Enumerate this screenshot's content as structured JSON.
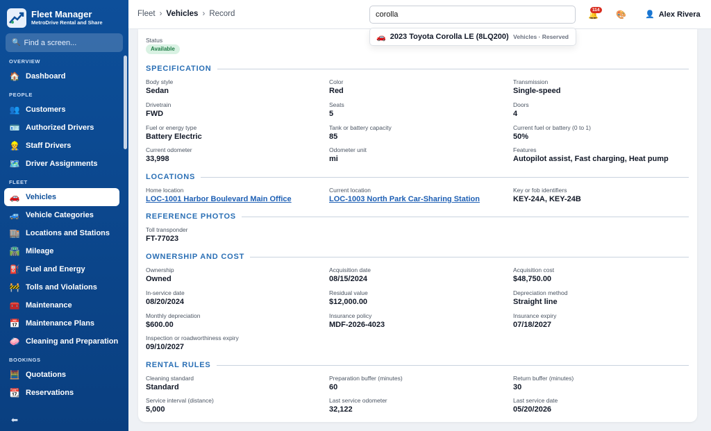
{
  "app": {
    "name": "Fleet Manager",
    "subtitle": "MetroDrive Rental and Share",
    "find_placeholder": "Find a screen..."
  },
  "sidebar": {
    "sections": {
      "overview": "OVERVIEW",
      "people": "PEOPLE",
      "fleet": "FLEET",
      "bookings": "BOOKINGS"
    },
    "items": {
      "dashboard": {
        "label": "Dashboard",
        "icon": "🏠"
      },
      "customers": {
        "label": "Customers",
        "icon": "👥"
      },
      "authorized_drivers": {
        "label": "Authorized Drivers",
        "icon": "🪪"
      },
      "staff_drivers": {
        "label": "Staff Drivers",
        "icon": "👷"
      },
      "driver_assignments": {
        "label": "Driver Assignments",
        "icon": "🗺️"
      },
      "vehicles": {
        "label": "Vehicles",
        "icon": "🚗"
      },
      "vehicle_categories": {
        "label": "Vehicle Categories",
        "icon": "🚙"
      },
      "locations_stations": {
        "label": "Locations and Stations",
        "icon": "🏬"
      },
      "mileage": {
        "label": "Mileage",
        "icon": "🛣️"
      },
      "fuel_energy": {
        "label": "Fuel and Energy",
        "icon": "⛽"
      },
      "tolls_violations": {
        "label": "Tolls and Violations",
        "icon": "🚧"
      },
      "maintenance": {
        "label": "Maintenance",
        "icon": "🧰"
      },
      "maintenance_plans": {
        "label": "Maintenance Plans",
        "icon": "📅"
      },
      "cleaning_preparation": {
        "label": "Cleaning and Preparation",
        "icon": "🧼"
      },
      "quotations": {
        "label": "Quotations",
        "icon": "🧮"
      },
      "reservations": {
        "label": "Reservations",
        "icon": "📆"
      }
    },
    "collapse_icon": "⬅"
  },
  "topbar": {
    "breadcrumb": [
      "Fleet",
      "Vehicles",
      "Record"
    ],
    "breadcrumb_sep": "›",
    "search_value": "corolla",
    "notification_count": "114",
    "user_name": "Alex Rivera"
  },
  "search_result": {
    "name": "2023 Toyota Corolla LE (8LQ200)",
    "meta": "Vehicles · Reserved"
  },
  "record": {
    "status_label": "Status",
    "status_value": "Available",
    "sections": {
      "specification": "SPECIFICATION",
      "locations": "LOCATIONS",
      "reference_photos": "REFERENCE PHOTOS",
      "ownership_cost": "OWNERSHIP AND COST",
      "rental_rules": "RENTAL RULES"
    },
    "specification": {
      "body_style": {
        "label": "Body style",
        "value": "Sedan"
      },
      "color": {
        "label": "Color",
        "value": "Red"
      },
      "transmission": {
        "label": "Transmission",
        "value": "Single-speed"
      },
      "drivetrain": {
        "label": "Drivetrain",
        "value": "FWD"
      },
      "seats": {
        "label": "Seats",
        "value": "5"
      },
      "doors": {
        "label": "Doors",
        "value": "4"
      },
      "fuel_type": {
        "label": "Fuel or energy type",
        "value": "Battery Electric"
      },
      "tank_capacity": {
        "label": "Tank or battery capacity",
        "value": "85"
      },
      "current_fuel": {
        "label": "Current fuel or battery (0 to 1)",
        "value": "50%"
      },
      "odometer": {
        "label": "Current odometer",
        "value": "33,998"
      },
      "odometer_unit": {
        "label": "Odometer unit",
        "value": "mi"
      },
      "features": {
        "label": "Features",
        "value": "Autopilot assist, Fast charging, Heat pump"
      }
    },
    "locations": {
      "home": {
        "label": "Home location",
        "value": "LOC-1001 Harbor Boulevard Main Office"
      },
      "current": {
        "label": "Current location",
        "value": "LOC-1003 North Park Car-Sharing Station"
      },
      "keys": {
        "label": "Key or fob identifiers",
        "value": "KEY-24A, KEY-24B"
      }
    },
    "reference_photos": {
      "toll": {
        "label": "Toll transponder",
        "value": "FT-77023"
      }
    },
    "ownership": {
      "ownership": {
        "label": "Ownership",
        "value": "Owned"
      },
      "acq_date": {
        "label": "Acquisition date",
        "value": "08/15/2024"
      },
      "acq_cost": {
        "label": "Acquisition cost",
        "value": "$48,750.00"
      },
      "in_service": {
        "label": "In-service date",
        "value": "08/20/2024"
      },
      "residual": {
        "label": "Residual value",
        "value": "$12,000.00"
      },
      "depreciation_method": {
        "label": "Depreciation method",
        "value": "Straight line"
      },
      "monthly_dep": {
        "label": "Monthly depreciation",
        "value": "$600.00"
      },
      "insurance_policy": {
        "label": "Insurance policy",
        "value": "MDF-2026-4023"
      },
      "insurance_expiry": {
        "label": "Insurance expiry",
        "value": "07/18/2027"
      },
      "inspection_expiry": {
        "label": "Inspection or roadworthiness expiry",
        "value": "09/10/2027"
      }
    },
    "rental_rules": {
      "cleaning": {
        "label": "Cleaning standard",
        "value": "Standard"
      },
      "prep_buffer": {
        "label": "Preparation buffer (minutes)",
        "value": "60"
      },
      "return_buffer": {
        "label": "Return buffer (minutes)",
        "value": "30"
      },
      "service_interval": {
        "label": "Service interval (distance)",
        "value": "5,000"
      },
      "last_service_odo": {
        "label": "Last service odometer",
        "value": "32,122"
      },
      "last_service_date": {
        "label": "Last service date",
        "value": "05/20/2026"
      }
    }
  }
}
